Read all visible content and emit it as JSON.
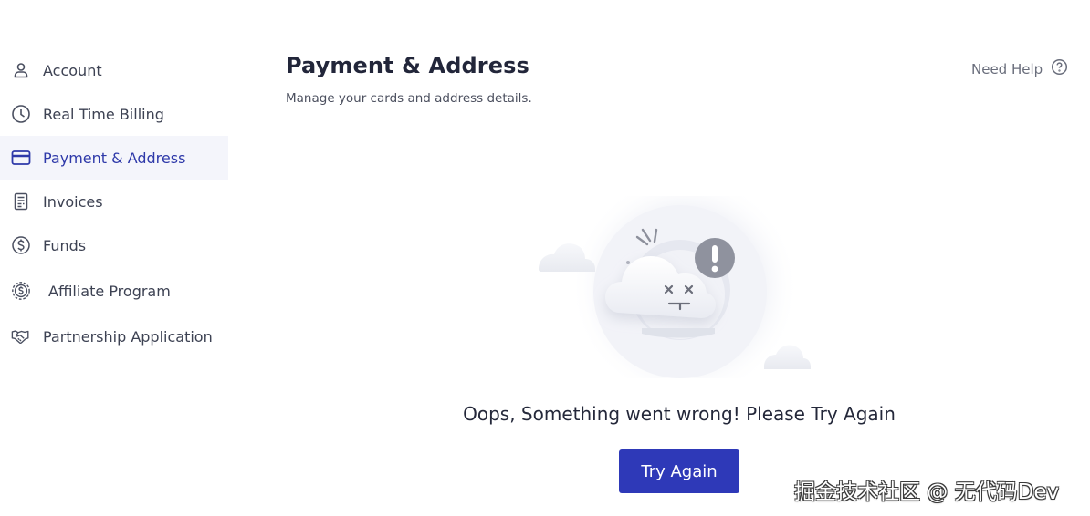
{
  "sidebar": {
    "items": [
      {
        "label": "Account",
        "icon": "user-icon",
        "active": false
      },
      {
        "label": "Real Time Billing",
        "icon": "clock-icon",
        "active": false
      },
      {
        "label": "Payment & Address",
        "icon": "credit-card-icon",
        "active": true
      },
      {
        "label": "Invoices",
        "icon": "invoice-icon",
        "active": false
      },
      {
        "label": "Funds",
        "icon": "dollar-circle-icon",
        "active": false
      },
      {
        "label": "Affiliate Program",
        "icon": "affiliate-dollar-icon",
        "active": false
      },
      {
        "label": "Partnership Application",
        "icon": "handshake-icon",
        "active": false
      }
    ]
  },
  "header": {
    "title": "Payment & Address",
    "subtitle": "Manage your cards and address details.",
    "help_label": "Need Help",
    "help_icon": "question-circle-icon"
  },
  "error_state": {
    "message": "Oops, Something went wrong! Please Try Again",
    "button_label": "Try Again",
    "illustration_icon": "sad-cloud-error-illustration"
  },
  "watermark": "掘金技术社区 @ 无代码Dev",
  "colors": {
    "accent": "#2e39b8",
    "active_bg": "#f4f5fb",
    "active_text": "#2e39a9",
    "text": "#3d4253"
  }
}
